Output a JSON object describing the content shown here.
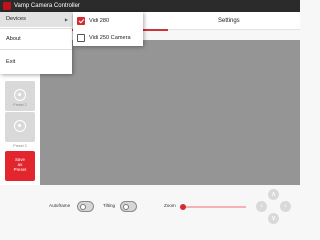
{
  "window": {
    "title": "Vamp Camera Controller"
  },
  "tabs": {
    "settings_label": "Settings"
  },
  "presets": [
    {
      "label": "Preset 2"
    },
    {
      "label": "Preset 3"
    }
  ],
  "save_preset": {
    "line1": "Save",
    "line2": "as",
    "line3": "Preset"
  },
  "controls": {
    "autoframe_label": "Autoframe",
    "autoframe_on": false,
    "tilting_label": "Tilting",
    "tilting_on": false,
    "zoom_label": "Zoom",
    "zoom_level": 0
  },
  "menu": {
    "items": [
      {
        "label": "Devices",
        "has_submenu": true,
        "active": true
      },
      {
        "label": "About"
      },
      {
        "label": "Exit"
      }
    ],
    "submenu_arrow": "▶"
  },
  "devices_submenu": [
    {
      "label": "Vidi 280",
      "checked": true
    },
    {
      "label": "Vidi 250 Camera",
      "checked": false
    }
  ],
  "dpad": {
    "up": "∧",
    "left": "‹",
    "right": "›",
    "down": "∨"
  },
  "colors": {
    "accent": "#d32b33",
    "video_bg": "#959595",
    "titlebar": "#2b2b2b"
  }
}
